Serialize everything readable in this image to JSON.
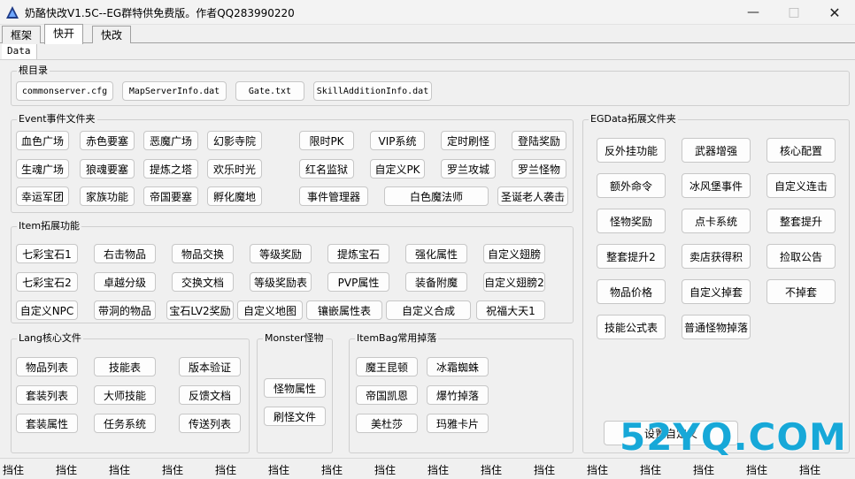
{
  "window": {
    "title": "奶酪快改V1.5C--EG群特供免费版。作者QQ283990220",
    "icon": "app-logo-icon"
  },
  "tabs": [
    "框架",
    "快开",
    "快改"
  ],
  "subtab": "Data",
  "root": {
    "title": "根目录",
    "buttons": [
      "commonserver.cfg",
      "MapServerInfo.dat",
      "Gate.txt",
      "SkillAdditionInfo.dat"
    ]
  },
  "event": {
    "title": "Event事件文件夹",
    "buttons": [
      "血色广场",
      "赤色要塞",
      "恶魔广场",
      "幻影寺院",
      "限时PK",
      "VIP系统",
      "定时刷怪",
      "登陆奖励",
      "生魂广场",
      "狼魂要塞",
      "提炼之塔",
      "欢乐时光",
      "红名监狱",
      "自定义PK",
      "罗兰攻城",
      "罗兰怪物",
      "幸运军团",
      "家族功能",
      "帝国要塞",
      "孵化魔地",
      "事件管理器",
      "白色魔法师",
      "圣诞老人袭击"
    ]
  },
  "item": {
    "title": "Item拓展功能",
    "buttons": [
      "七彩宝石1",
      "右击物品",
      "物品交换",
      "等级奖励",
      "提炼宝石",
      "强化属性",
      "自定义翅膀",
      "七彩宝石2",
      "卓越分级",
      "交换文档",
      "等级奖励表",
      "PVP属性",
      "装备附魔",
      "自定义翅膀2",
      "自定义NPC",
      "带洞的物品",
      "宝石LV2奖励",
      "自定义地图",
      "镶嵌属性表",
      "自定义合成",
      "祝福大天1"
    ]
  },
  "lang": {
    "title": "Lang核心文件",
    "buttons": [
      "物品列表",
      "技能表",
      "版本验证",
      "套装列表",
      "大师技能",
      "反馈文档",
      "套装属性",
      "任务系统",
      "传送列表"
    ]
  },
  "monster": {
    "title": "Monster怪物",
    "buttons": [
      "怪物属性",
      "刷怪文件"
    ]
  },
  "itembag": {
    "title": "ItemBag常用掉落",
    "buttons": [
      "魔王昆顿",
      "冰霜蜘蛛",
      "帝国凯恩",
      "爆竹掉落",
      "美杜莎",
      "玛雅卡片"
    ]
  },
  "egdata": {
    "title": "EGData拓展文件夹",
    "buttons": [
      "反外挂功能",
      "武器增强",
      "核心配置",
      "额外命令",
      "冰风堡事件",
      "自定义连击",
      "怪物奖励",
      "点卡系统",
      "整套提升",
      "整套提升2",
      "卖店获得积",
      "捡取公告",
      "物品价格",
      "自定义掉套",
      "不掉套",
      "技能公式表",
      "普通怪物掉落"
    ],
    "bottom_button": "设置自定义"
  },
  "status": {
    "cells": [
      "挡住",
      "挡住",
      "挡住",
      "挡住",
      "挡住",
      "挡住",
      "挡住",
      "挡住",
      "挡住",
      "挡住",
      "挡住",
      "挡住",
      "挡住",
      "挡住",
      "挡住",
      "挡住"
    ]
  },
  "watermark": "52YQ.COM"
}
